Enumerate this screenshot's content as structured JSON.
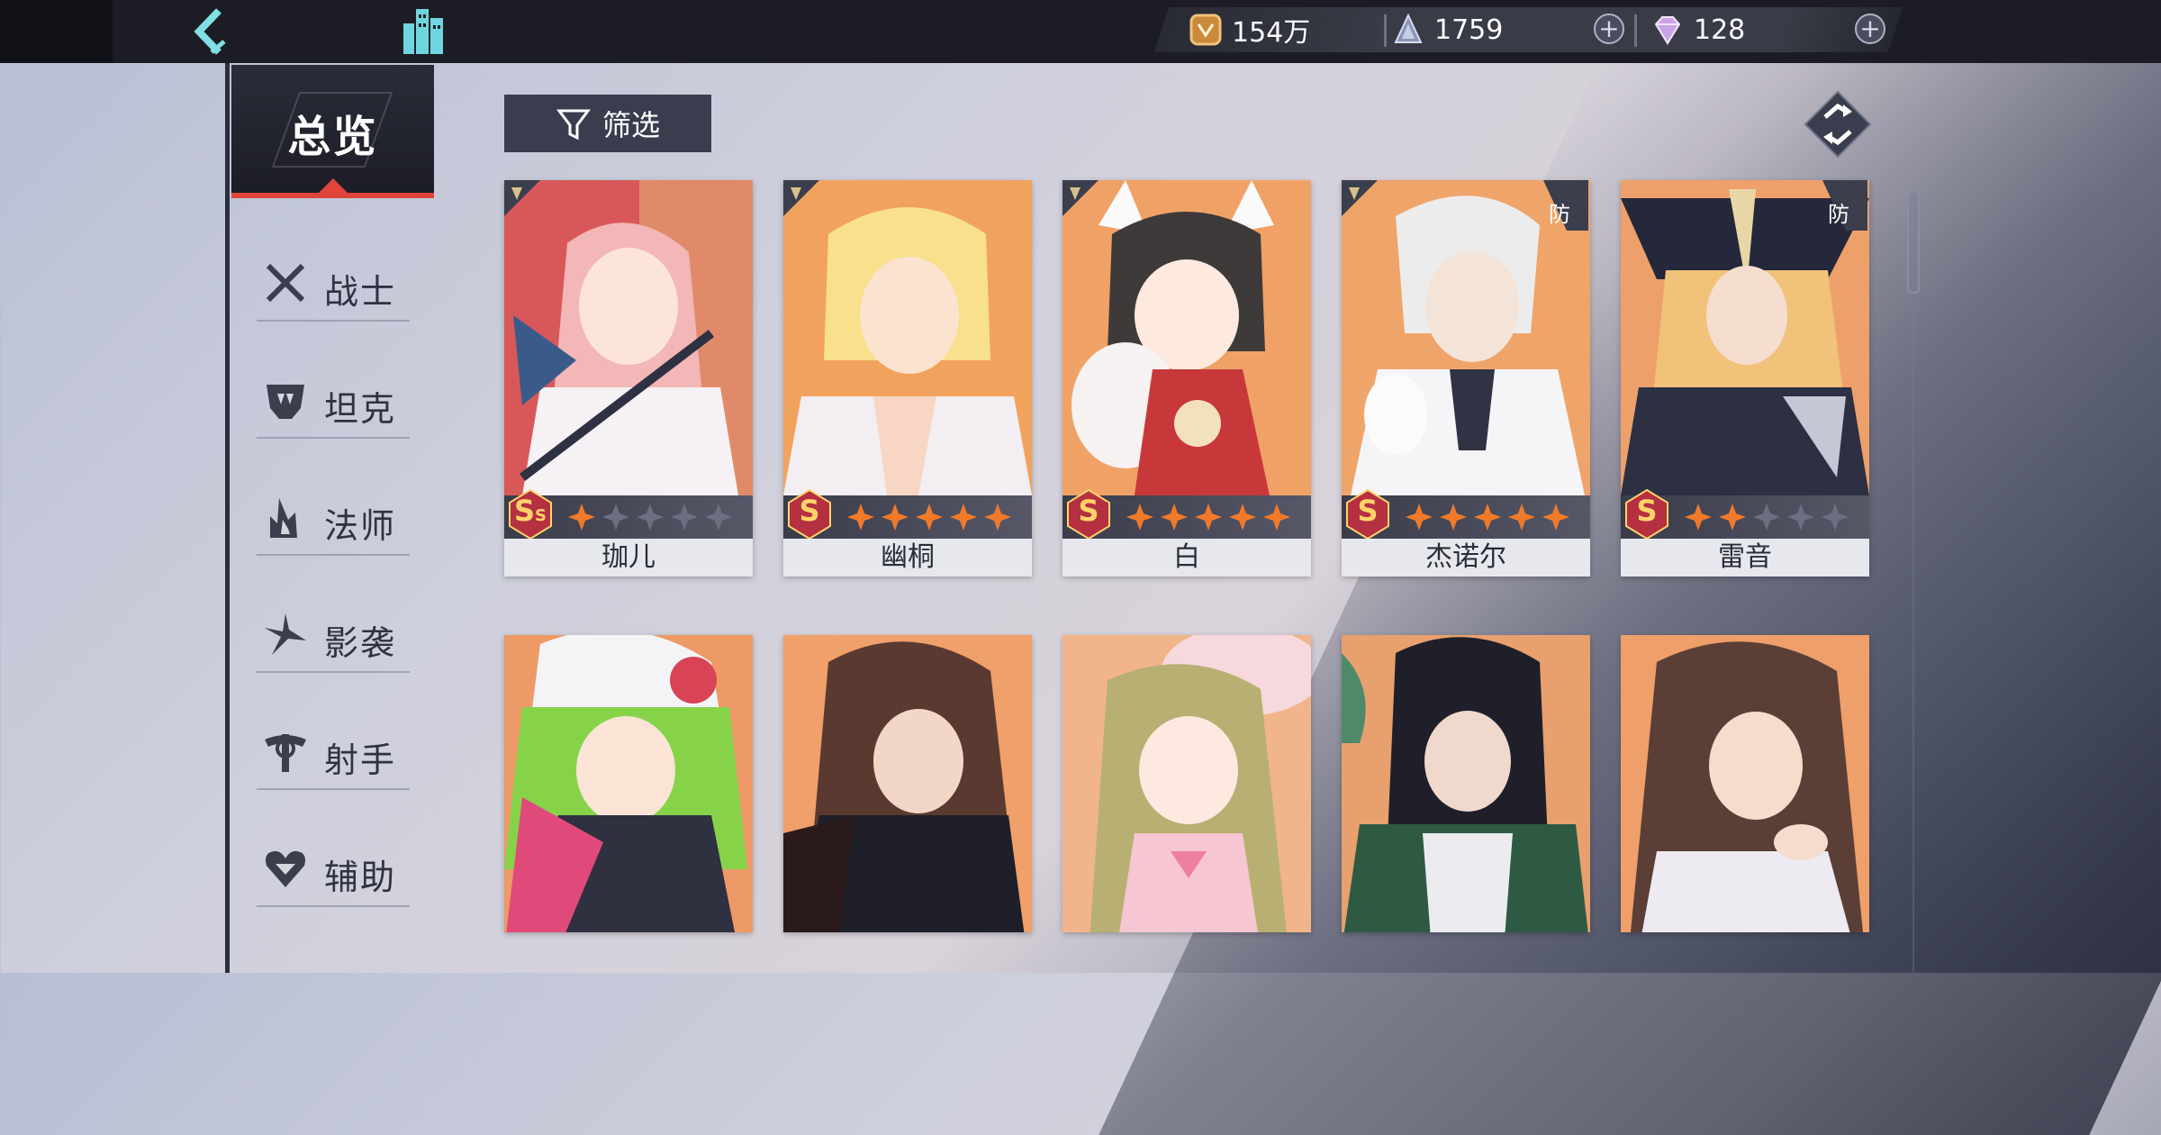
{
  "topbar": {
    "gold": "154万",
    "energy": "1759",
    "gems": "128",
    "plus": "+"
  },
  "sidebar": {
    "overview": "总览",
    "categories": [
      {
        "label": "战士",
        "icon": "crossed-swords-icon"
      },
      {
        "label": "坦克",
        "icon": "helmet-icon"
      },
      {
        "label": "法师",
        "icon": "magic-flame-icon"
      },
      {
        "label": "影袭",
        "icon": "shuriken-icon"
      },
      {
        "label": "射手",
        "icon": "crossbow-icon"
      },
      {
        "label": "辅助",
        "icon": "heart-icon"
      }
    ]
  },
  "filter": {
    "label": "筛选"
  },
  "colors": {
    "accent": "#e0443a",
    "rank_gold": "#ffd36a",
    "star_orange": "#f07a2a"
  },
  "cards_row1": [
    {
      "name": "珈儿",
      "rank": "S",
      "rank_sub": "S",
      "stars": 1,
      "def_badge": ""
    },
    {
      "name": "幽桐",
      "rank": "S",
      "rank_sub": "",
      "stars": 5,
      "def_badge": ""
    },
    {
      "name": "白",
      "rank": "S",
      "rank_sub": "",
      "stars": 5,
      "def_badge": ""
    },
    {
      "name": "杰诺尔",
      "rank": "S",
      "rank_sub": "",
      "stars": 5,
      "def_badge": "防"
    },
    {
      "name": "雷音",
      "rank": "S",
      "rank_sub": "",
      "stars": 2,
      "def_badge": "防"
    }
  ]
}
